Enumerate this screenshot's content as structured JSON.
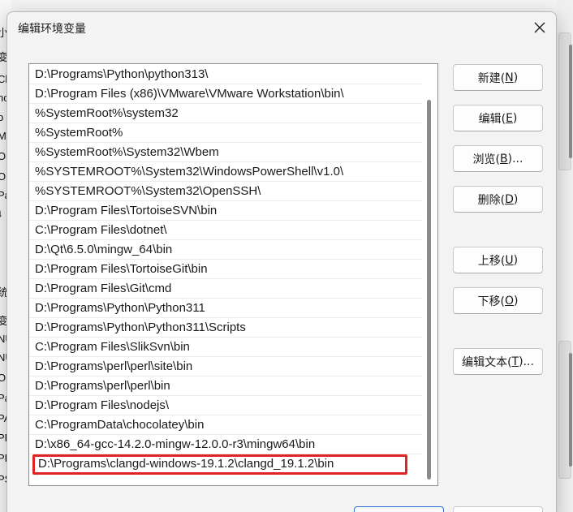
{
  "dialog": {
    "title": "编辑环境变量",
    "close_icon": "close-icon"
  },
  "paths": [
    "D:\\Programs\\Python\\python313\\",
    "D:\\Program Files (x86)\\VMware\\VMware Workstation\\bin\\",
    "%SystemRoot%\\system32",
    "%SystemRoot%",
    "%SystemRoot%\\System32\\Wbem",
    "%SYSTEMROOT%\\System32\\WindowsPowerShell\\v1.0\\",
    "%SYSTEMROOT%\\System32\\OpenSSH\\",
    "D:\\Program Files\\TortoiseSVN\\bin",
    "C:\\Program Files\\dotnet\\",
    "D:\\Qt\\6.5.0\\mingw_64\\bin",
    "D:\\Program Files\\TortoiseGit\\bin",
    "D:\\Program Files\\Git\\cmd",
    "D:\\Programs\\Python\\Python311",
    "D:\\Programs\\Python\\Python311\\Scripts",
    "C:\\Program Files\\SlikSvn\\bin",
    "D:\\Programs\\perl\\perl\\site\\bin",
    "D:\\Programs\\perl\\perl\\bin",
    "D:\\Program Files\\nodejs\\",
    "C:\\ProgramData\\chocolatey\\bin",
    "D:\\x86_64-gcc-14.2.0-mingw-12.0.0-r3\\mingw64\\bin",
    "D:\\Programs\\clangd-windows-19.1.2\\clangd_19.1.2\\bin"
  ],
  "selected_index": 20,
  "highlight_color": "#e02323",
  "buttons": {
    "new": {
      "label": "新建(",
      "key": "N",
      "end": ")"
    },
    "edit": {
      "label": "编辑(",
      "key": "E",
      "end": ")"
    },
    "browse": {
      "label": "浏览(",
      "key": "B",
      "end": ")..."
    },
    "delete": {
      "label": "删除(",
      "key": "D",
      "end": ")"
    },
    "move_up": {
      "label": "上移(",
      "key": "U",
      "end": ")"
    },
    "move_down": {
      "label": "下移(",
      "key": "O",
      "end": ")"
    },
    "edit_text": {
      "label": "编辑文本(",
      "key": "T",
      "end": ")..."
    }
  },
  "background_fragments": [
    "小",
    "变",
    "Ch",
    "nc",
    "b",
    "MS",
    "Or",
    "Or",
    "Pa",
    "↓",
    "统",
    "变",
    "NU",
    "NU",
    "OS",
    "Pa",
    "PA",
    "PR",
    "PR",
    "PS"
  ]
}
